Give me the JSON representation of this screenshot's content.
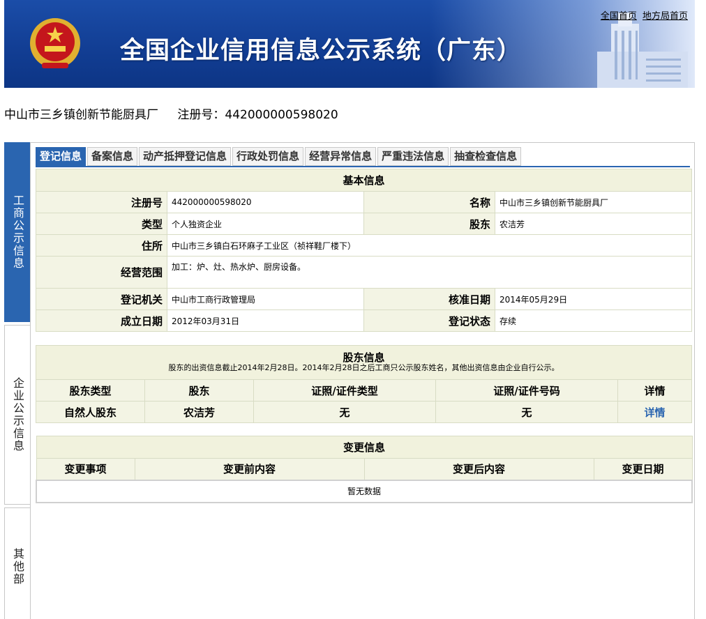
{
  "header": {
    "title": "全国企业信用信息公示系统（广东）",
    "links": [
      "全国首页",
      "地方局首页"
    ]
  },
  "company": {
    "name": "中山市三乡镇创新节能厨具厂",
    "reg_no_label": "注册号：442000000598020"
  },
  "sidebar": {
    "items": [
      {
        "label": "工商公示信息",
        "active": true
      },
      {
        "label": "企业公示信息",
        "active": false
      },
      {
        "label": "其他部",
        "active": false
      }
    ]
  },
  "tabs": [
    "登记信息",
    "备案信息",
    "动产抵押登记信息",
    "行政处罚信息",
    "经营异常信息",
    "严重违法信息",
    "抽查检查信息"
  ],
  "basic": {
    "title": "基本信息",
    "reg_no_label": "注册号",
    "reg_no": "442000000598020",
    "name_label": "名称",
    "name": "中山市三乡镇创新节能厨具厂",
    "type_label": "类型",
    "type": "个人独资企业",
    "shareholder_label": "股东",
    "shareholder": "农洁芳",
    "address_label": "住所",
    "address": "中山市三乡镇白石环麻子工业区（祯祥鞋厂楼下）",
    "scope_label": "经营范围",
    "scope": "加工：炉、灶、热水炉、厨房设备。",
    "authority_label": "登记机关",
    "authority": "中山市工商行政管理局",
    "approve_date_label": "核准日期",
    "approve_date": "2014年05月29日",
    "found_date_label": "成立日期",
    "found_date": "2012年03月31日",
    "status_label": "登记状态",
    "status": "存续"
  },
  "shareholders": {
    "title": "股东信息",
    "note": "股东的出资信息截止2014年2月28日。2014年2月28日之后工商只公示股东姓名，其他出资信息由企业自行公示。",
    "columns": [
      "股东类型",
      "股东",
      "证照/证件类型",
      "证照/证件号码",
      "详情"
    ],
    "rows": [
      {
        "type": "自然人股东",
        "name": "农洁芳",
        "id_type": "无",
        "id_no": "无",
        "detail": "详情"
      }
    ]
  },
  "changes": {
    "title": "变更信息",
    "columns": [
      "变更事项",
      "变更前内容",
      "变更后内容",
      "变更日期"
    ],
    "empty": "暂无数据"
  }
}
